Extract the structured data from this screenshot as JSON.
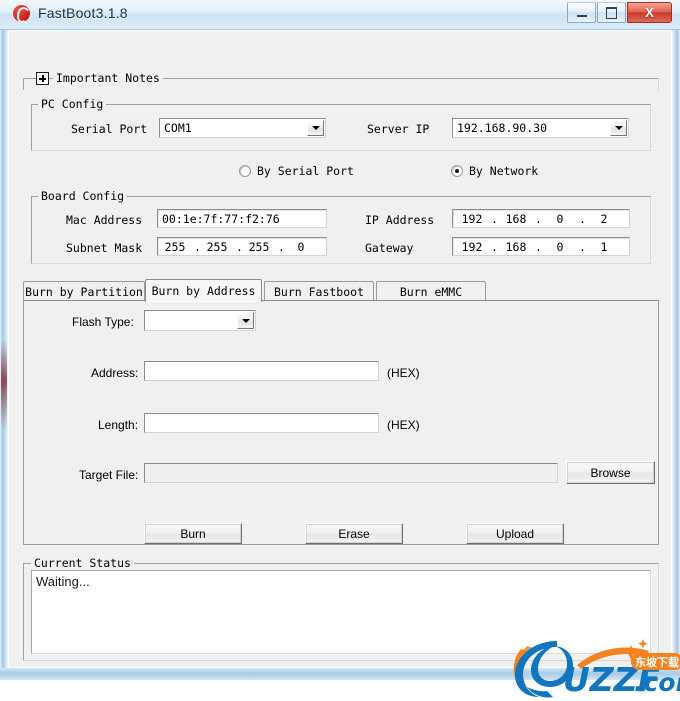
{
  "window": {
    "title": "FastBoot3.1.8",
    "app_icon": "fastboot-logo-icon",
    "minimize_glyph": "minimize-icon",
    "maximize_glyph": "maximize-icon",
    "close_glyph": "X"
  },
  "notes": {
    "expander_state": "+",
    "label": "Important Notes"
  },
  "pc_config": {
    "group_label": "PC Config",
    "serial_port_label": "Serial Port",
    "serial_port_value": "COM1",
    "server_ip_label": "Server IP",
    "server_ip_value": "192.168.90.30"
  },
  "mode": {
    "options": [
      {
        "label": "By Serial Port",
        "selected": false
      },
      {
        "label": "By Network",
        "selected": true
      }
    ]
  },
  "board_config": {
    "group_label": "Board Config",
    "mac_address_label": "Mac Address",
    "mac_address_value": "00:1e:7f:77:f2:76",
    "subnet_mask_label": "Subnet Mask",
    "subnet_mask_octets": [
      "255",
      "255",
      "255",
      "0"
    ],
    "ip_address_label": "IP Address",
    "ip_address_octets": [
      "192",
      "168",
      "0",
      "2"
    ],
    "gateway_label": "Gateway",
    "gateway_octets": [
      "192",
      "168",
      "0",
      "1"
    ],
    "octet_separator": "."
  },
  "tabs": {
    "items": [
      {
        "label": "Burn by Partition",
        "active": false
      },
      {
        "label": "Burn by Address",
        "active": true
      },
      {
        "label": "Burn Fastboot",
        "active": false
      },
      {
        "label": "Burn eMMC",
        "active": false
      }
    ]
  },
  "burn_by_address": {
    "flash_type_label": "Flash Type:",
    "flash_type_value": "",
    "address_label": "Address:",
    "address_value": "",
    "address_hint": "(HEX)",
    "length_label": "Length:",
    "length_value": "",
    "length_hint": "(HEX)",
    "target_file_label": "Target File:",
    "target_file_value": "",
    "browse_label": "Browse",
    "burn_label": "Burn",
    "erase_label": "Erase",
    "upload_label": "Upload"
  },
  "status": {
    "group_label": "Current Status",
    "text": "Waiting..."
  },
  "watermark": {
    "brand": "UZZF",
    "domain": ".com",
    "badge_text": "东坡下载",
    "blue": "#1275c0",
    "orange": "#f4821f"
  },
  "theme": {
    "client_bg": "#f0f0f0",
    "field_bg": "#ffffff",
    "border": "#a0a0a0",
    "titlebar_text": "#1b2d40",
    "close_red": "#c8392a"
  }
}
